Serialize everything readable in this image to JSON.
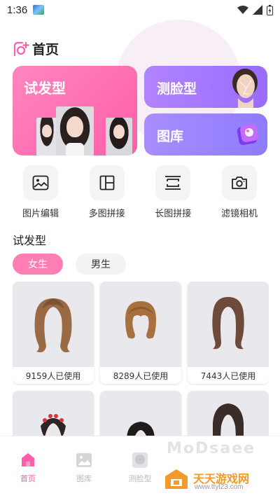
{
  "status_bar": {
    "time": "1:36"
  },
  "header": {
    "title": "首页"
  },
  "cards": {
    "hairstyle": "试发型",
    "face_test": "测脸型",
    "gallery": "图库"
  },
  "tools": [
    {
      "label": "图片编辑",
      "icon": "image-edit-icon"
    },
    {
      "label": "多图拼接",
      "icon": "grid-layout-icon"
    },
    {
      "label": "长图拼接",
      "icon": "long-image-icon"
    },
    {
      "label": "滤镜相机",
      "icon": "camera-icon"
    }
  ],
  "section": {
    "title": "试发型"
  },
  "gender_tabs": [
    {
      "label": "女生",
      "selected": true
    },
    {
      "label": "男生",
      "selected": false
    }
  ],
  "hairstyles": [
    {
      "usage": "9159人已使用",
      "hair_color": "#9a6a45"
    },
    {
      "usage": "8289人已使用",
      "hair_color": "#a8703f"
    },
    {
      "usage": "7443人已使用",
      "hair_color": "#6e4a3a"
    },
    {
      "usage": "",
      "hair_color": "#2e2424"
    },
    {
      "usage": "",
      "hair_color": "#1f1b1b"
    },
    {
      "usage": "",
      "hair_color": "#3a2c28"
    }
  ],
  "bottom_nav": [
    {
      "label": "首页",
      "active": true
    },
    {
      "label": "图库",
      "active": false
    },
    {
      "label": "测脸型",
      "active": false
    }
  ],
  "watermark": {
    "name": "天天游戏网",
    "url": "www.ttyl23.com"
  },
  "colors": {
    "accent_pink": "#ff5ea8",
    "purple": "#9a6cff"
  }
}
